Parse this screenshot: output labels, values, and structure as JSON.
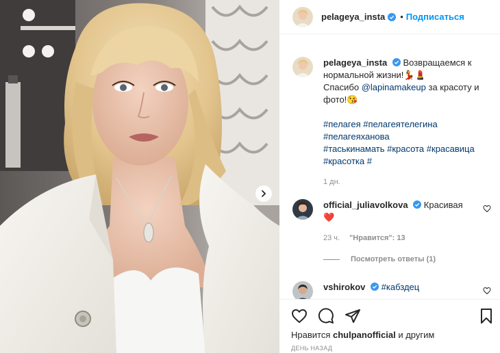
{
  "post": {
    "author": "pelageya_insta",
    "follow_label": "Подписаться",
    "dot": "•",
    "has_next_photo": true
  },
  "caption": {
    "username": "pelageya_insta",
    "line1_text": "Возвращаемся к нормальной жизни!",
    "line1_emoji": "💃💄",
    "line2_prefix": "Спасибо ",
    "mention": "@lapinamakeup",
    "line2_suffix": " за красоту и фото!",
    "line2_emoji": "😘",
    "hashtags": [
      "#пелагея",
      "#пелагеятелегина",
      "#пелагеяханова",
      "#таськинамать",
      "#красота",
      "#красавица",
      "#красотка",
      "#"
    ],
    "time": "1 дн."
  },
  "comments": [
    {
      "username": "official_juliavolkova",
      "text": "Красивая",
      "emoji": "❤️",
      "time": "23 ч.",
      "likes_label": "\"Нравится\": 13",
      "replies_label": "Посмотреть ответы (1)"
    },
    {
      "username": "vshirokov",
      "text": "#кабздец"
    }
  ],
  "footer": {
    "liked_prefix": "Нравится ",
    "liked_user": "chulpanofficial",
    "liked_suffix": " и другим",
    "date": "ДЕНЬ НАЗАД"
  },
  "icons": {
    "like": "heart-outline-icon",
    "comment": "comment-bubble-icon",
    "share": "paper-plane-icon",
    "save": "bookmark-icon",
    "verified": "verified-badge-icon",
    "next": "chevron-right-icon"
  },
  "colors": {
    "link_blue": "#0095f6",
    "hashtag": "#00376b",
    "verified": "#3897f0",
    "muted": "#8e8e8e",
    "like_red": "#ed4956"
  }
}
